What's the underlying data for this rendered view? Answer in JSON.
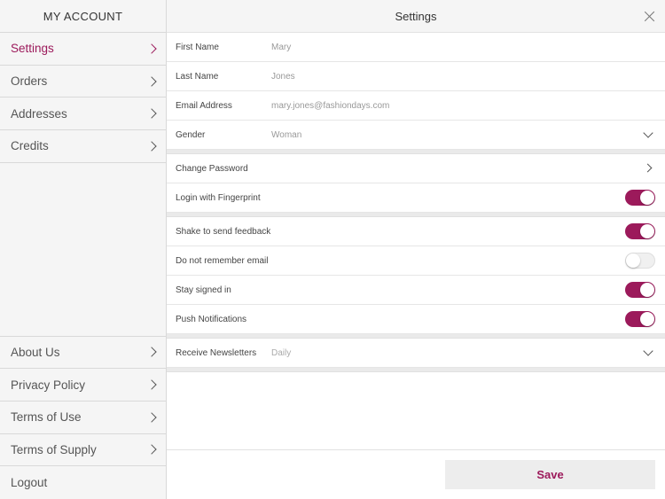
{
  "sidebar": {
    "title": "MY ACCOUNT",
    "top_items": [
      {
        "label": "Settings"
      },
      {
        "label": "Orders"
      },
      {
        "label": "Addresses"
      },
      {
        "label": "Credits"
      }
    ],
    "bottom_items": [
      {
        "label": "About Us"
      },
      {
        "label": "Privacy Policy"
      },
      {
        "label": "Terms of Use"
      },
      {
        "label": "Terms of Supply"
      },
      {
        "label": "Logout"
      }
    ]
  },
  "main": {
    "title": "Settings",
    "profile": {
      "first_name_label": "First Name",
      "first_name_value": "Mary",
      "last_name_label": "Last Name",
      "last_name_value": "Jones",
      "email_label": "Email Address",
      "email_value": "mary.jones@fashiondays.com",
      "gender_label": "Gender",
      "gender_value": "Woman"
    },
    "security": {
      "change_password_label": "Change Password",
      "fingerprint_label": "Login with Fingerprint",
      "fingerprint_on": true
    },
    "preferences": {
      "shake_label": "Shake to send feedback",
      "shake_on": true,
      "no_remember_label": "Do not remember email",
      "no_remember_on": false,
      "stay_signed_label": "Stay signed in",
      "stay_signed_on": true,
      "push_label": "Push Notifications",
      "push_on": true
    },
    "newsletter": {
      "label": "Receive Newsletters",
      "value": "Daily"
    },
    "save_label": "Save"
  },
  "colors": {
    "accent": "#9c1a5b",
    "sidebar_bg": "#f5f5f5"
  }
}
